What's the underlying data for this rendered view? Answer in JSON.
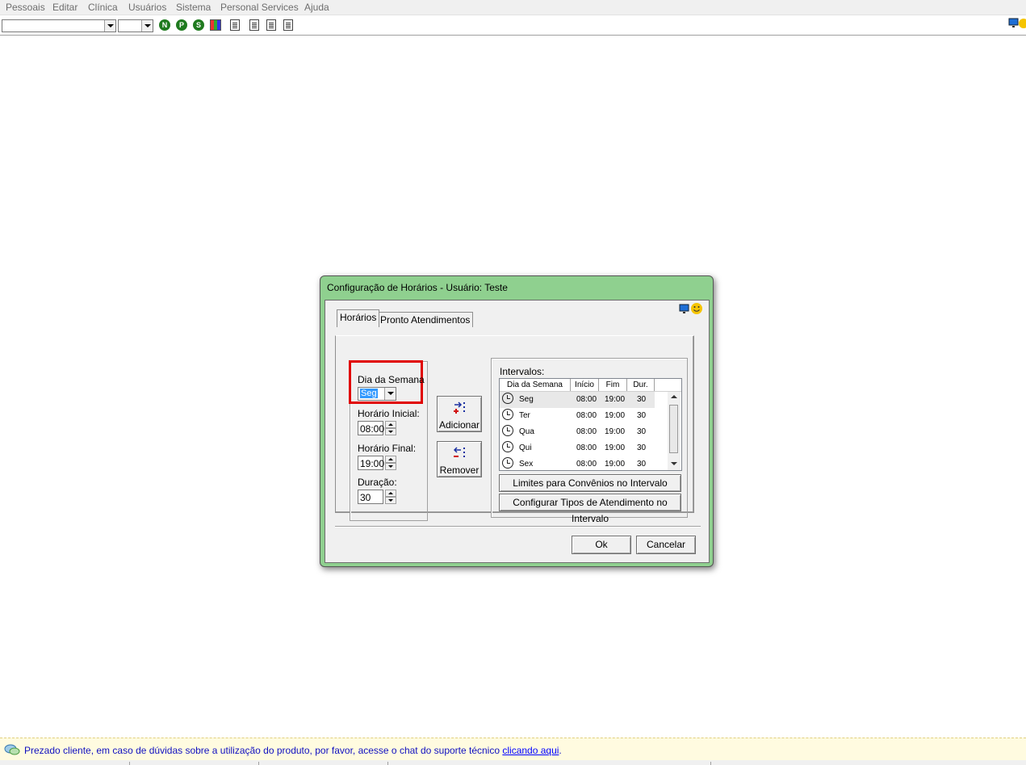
{
  "menu": [
    "Pessoais",
    "Editar",
    "Clínica",
    "Usuários",
    "Sistema",
    "Personal Services",
    "Ajuda"
  ],
  "toolbar": {
    "icons": [
      "nav-n-icon",
      "nav-p-icon",
      "nav-s-icon",
      "grid-icon",
      "doc-icon",
      "doc-icon",
      "doc-icon",
      "doc-icon"
    ]
  },
  "dialog": {
    "title": "Configuração de Horários - Usuário: Teste",
    "tabs": [
      "Horários",
      "Pronto Atendimentos"
    ],
    "dia_semana_label": "Dia da Semana",
    "dia_semana_value": "Seg",
    "horario_inicial_label": "Horário Inicial:",
    "horario_inicial_value": "08:00",
    "horario_final_label": "Horário Final:",
    "horario_final_value": "19:00",
    "duracao_label": "Duração:",
    "duracao_value": "30",
    "adicionar_label": "Adicionar",
    "remover_label": "Remover",
    "intervalos_label": "Intervalos:",
    "columns": [
      "Dia da Semana",
      "Início",
      "Fim",
      "Dur."
    ],
    "rows": [
      {
        "dia": "Seg",
        "inicio": "08:00",
        "fim": "19:00",
        "dur": "30"
      },
      {
        "dia": "Ter",
        "inicio": "08:00",
        "fim": "19:00",
        "dur": "30"
      },
      {
        "dia": "Qua",
        "inicio": "08:00",
        "fim": "19:00",
        "dur": "30"
      },
      {
        "dia": "Qui",
        "inicio": "08:00",
        "fim": "19:00",
        "dur": "30"
      },
      {
        "dia": "Sex",
        "inicio": "08:00",
        "fim": "19:00",
        "dur": "30"
      }
    ],
    "limites_label": "Limites para Convênios no Intervalo",
    "configurar_label": "Configurar Tipos de Atendimento no Intervalo",
    "ok_label": "Ok",
    "cancelar_label": "Cancelar"
  },
  "status": {
    "message": "Prezado cliente, em caso de dúvidas sobre a utilização do produto, por favor, acesse o chat do suporte técnico ",
    "link": "clicando aqui",
    "end": "."
  },
  "colors": {
    "highlight": "#e00000",
    "dialog_frame": "#8fd08f"
  }
}
